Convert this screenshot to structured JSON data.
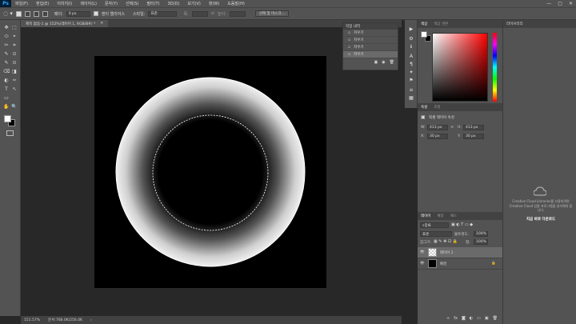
{
  "menubar": {
    "logo": "Ps",
    "items": [
      "파일(F)",
      "편집(E)",
      "이미지(I)",
      "레이어(L)",
      "문자(Y)",
      "선택(S)",
      "필터(T)",
      "3D(D)",
      "보기(V)",
      "창(W)",
      "도움말(H)"
    ],
    "window_controls": [
      "—",
      "▢",
      "✕"
    ]
  },
  "options": {
    "feather_label": "페더:",
    "feather_value": "0 px",
    "antialias_label": "앤티 앨리어스",
    "style_label": "스타일:",
    "style_value": "표준",
    "width_label": "폭:",
    "height_label": "높이:",
    "select_mask_button": "선택 및 마스크..."
  },
  "document": {
    "tab_title": "제목 없음-1 @ 152%(레이어 1, RGB/8#) *",
    "zoom": "151.57%",
    "doc_info": "문서:768.0K/256.0K"
  },
  "history": {
    "title": "작업 내역",
    "items": [
      "지우기",
      "지우기",
      "지우기",
      "지우기"
    ]
  },
  "color": {
    "tabs": [
      "색상",
      "색상 견본"
    ],
    "fg": "#ffffff",
    "bg": "#000000"
  },
  "properties": {
    "tabs": [
      "속성",
      "조정"
    ],
    "section": "픽셀 레이어 속성",
    "w_label": "W:",
    "w_value": "413 px",
    "h_label": "H:",
    "h_value": "413 px",
    "x_label": "X:",
    "x_value": "30 px",
    "y_label": "Y:",
    "y_value": "30 px",
    "link_symbol": "∞"
  },
  "layers": {
    "tabs": [
      "레이어",
      "채널",
      "패스"
    ],
    "kind_label": "종류",
    "blend_mode": "표준",
    "opacity_label": "불투명도:",
    "opacity_value": "100%",
    "lock_label": "잠그기:",
    "fill_label": "칠:",
    "fill_value": "100%",
    "rows": [
      {
        "name": "레이어 1",
        "selected": true
      },
      {
        "name": "배경",
        "selected": false
      }
    ]
  },
  "libraries": {
    "title": "라이브러리",
    "message": "Creative Cloud Libraries를 사용하려면 Creative Cloud 업용 프로그램을 설치해야 합니다.",
    "link": "지금 바로 다운로드"
  },
  "tools": [
    "⬚",
    "⬭",
    "✥",
    "⌖",
    "✂",
    "⌗",
    "✎",
    "⊙",
    "⌫",
    "◨",
    "◐",
    "✑",
    "T",
    "↖",
    "▭",
    "✋",
    "🔍",
    "⋯"
  ],
  "strip_icons": [
    "▶",
    "⚙",
    "ℹ",
    "A",
    "¶",
    "✦",
    "⚑",
    "≡",
    "▦",
    "◆",
    "▤"
  ]
}
